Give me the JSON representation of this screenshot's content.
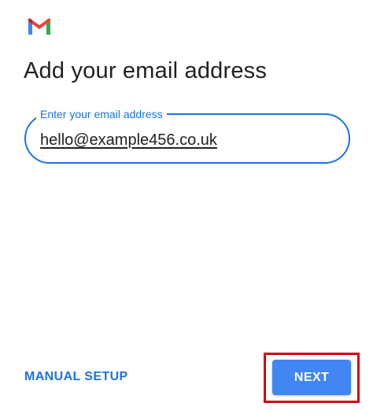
{
  "app": {
    "logo_icon": "gmail-logo-icon",
    "title": "Add your email address"
  },
  "email_field": {
    "label": "Enter your email address",
    "value": "hello@example456.co.uk"
  },
  "actions": {
    "manual_setup_label": "MANUAL SETUP",
    "next_label": "NEXT"
  },
  "colors": {
    "accent": "#1a73e8",
    "button": "#4285f4",
    "highlight": "#d0021b",
    "text": "#202124"
  }
}
